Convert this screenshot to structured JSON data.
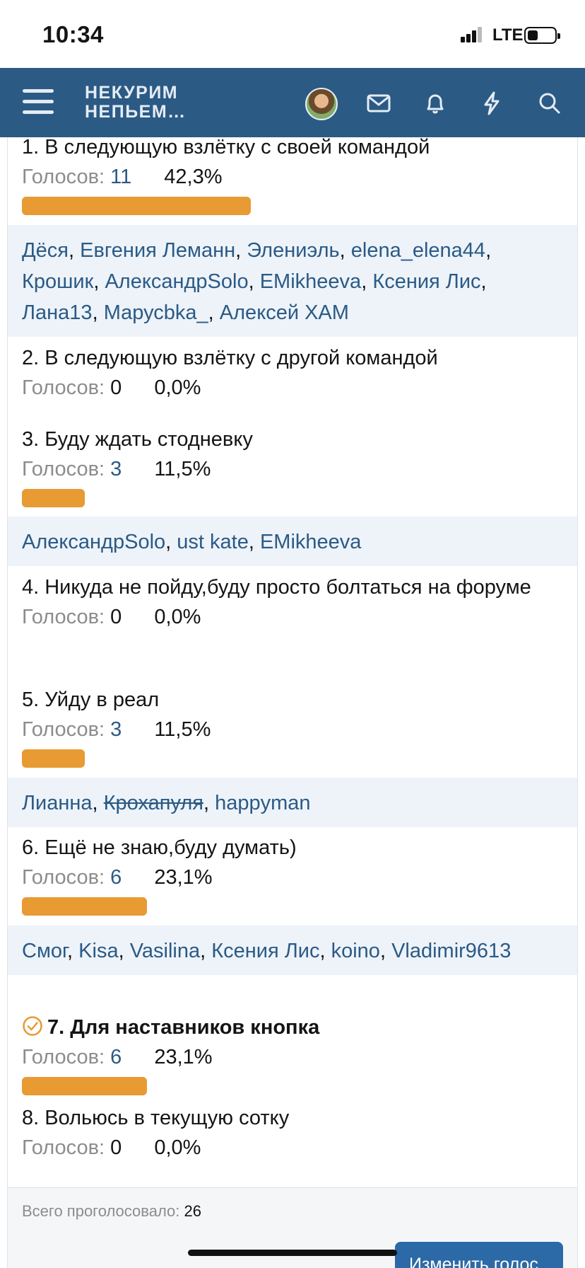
{
  "status": {
    "time": "10:34",
    "network": "LTE"
  },
  "nav": {
    "logo_line1": "НЕКУРИМ",
    "logo_line2": "НЕПЬЕМ…"
  },
  "poll": {
    "votes_label": "Голосов:",
    "options": [
      {
        "title": "1. В следующую взлётку с своей командой",
        "votes": "11",
        "percent": "42,3%",
        "share": 0.423,
        "voters": [
          "Дёся",
          "Евгения Леманн",
          "Элениэль",
          "elena_elena44",
          "Крошик",
          "АлександрSolo",
          "EMikheeva",
          "Ксения Лис",
          "Лана13",
          "Марусbka_",
          "Алексей ХАМ"
        ]
      },
      {
        "title": "2. В следующую взлётку с другой командой",
        "votes": "0",
        "percent": "0,0%",
        "share": 0
      },
      {
        "title": "3. Буду ждать стодневку",
        "votes": "3",
        "percent": "11,5%",
        "share": 0.115,
        "voters": [
          "АлександрSolo",
          "ust kate",
          "EMikheeva"
        ]
      },
      {
        "title": "4. Никуда не пойду,буду просто болтаться на форуме",
        "votes": "0",
        "percent": "0,0%",
        "share": 0
      },
      {
        "title": "5. Уйду в реал",
        "votes": "3",
        "percent": "11,5%",
        "share": 0.115,
        "voters": [
          "Лианна",
          "Крохапуля",
          "happyman"
        ]
      },
      {
        "title": "6. Ещё не знаю,буду думать)",
        "votes": "6",
        "percent": "23,1%",
        "share": 0.231,
        "voters": [
          "Смог",
          "Kisa",
          "Vasilina",
          "Ксения Лис",
          "koino",
          "Vladimir9613"
        ]
      },
      {
        "title": "7. Для наставников кнопка",
        "votes": "6",
        "percent": "23,1%",
        "share": 0.231,
        "selected": true
      },
      {
        "title": "8. Вольюсь в текущую сотку",
        "votes": "0",
        "percent": "0,0%",
        "share": 0
      }
    ],
    "total_label": "Всего проголосовало:",
    "total_value": "26",
    "change_vote_label": "Изменить голос"
  },
  "colors": {
    "nav_bg": "#2b5a85",
    "bar": "#e89a33",
    "link": "#2b5a85",
    "voters_bg": "#edf3f9"
  }
}
